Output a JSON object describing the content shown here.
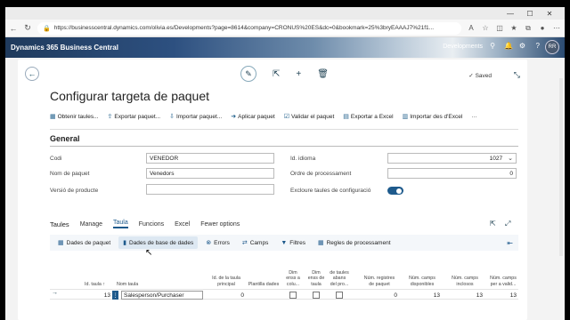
{
  "browser": {
    "url": "https://businesscentral.dynamics.com/olivia.es/Developments?page=8614&company=CRONUS%20ES&dc=0&bookmark=25%3bryEAAAJ7%21f1..."
  },
  "app": {
    "name": "Dynamics 365 Business Central",
    "environment": "Developments",
    "avatar_initials": "RR"
  },
  "page": {
    "title": "Configurar targeta de paquet",
    "saved_label": "Saved"
  },
  "actions": [
    {
      "label": "Obtenir taules...",
      "icon": "table-icon"
    },
    {
      "label": "Exportar paquet...",
      "icon": "export-icon"
    },
    {
      "label": "Importar paquet...",
      "icon": "import-icon"
    },
    {
      "label": "Aplicar paquet",
      "icon": "apply-icon"
    },
    {
      "label": "Validar el paquet",
      "icon": "validate-icon"
    },
    {
      "label": "Exportar a Excel",
      "icon": "excel-export-icon"
    },
    {
      "label": "Importar des d'Excel",
      "icon": "excel-import-icon"
    },
    {
      "label": "···",
      "icon": "more-icon"
    }
  ],
  "general": {
    "heading": "General",
    "codi_label": "Codi",
    "codi_value": "VENEDOR",
    "nom_label": "Nom de paquet",
    "nom_value": "Venedors",
    "versio_label": "Versió de producte",
    "versio_value": "",
    "idioma_label": "Id. idioma",
    "idioma_value": "1027",
    "ordre_label": "Ordre de processament",
    "ordre_value": "0",
    "excloure_label": "Excloure taules de configuració",
    "excloure_on": true
  },
  "tabs": {
    "title": "Taules",
    "items": [
      "Manage",
      "Taula",
      "Funcions",
      "Excel",
      "Fewer options"
    ],
    "active": "Taula"
  },
  "subactions": [
    {
      "label": "Dades de paquet",
      "icon": "package-data-icon"
    },
    {
      "label": "Dades de base de dades",
      "icon": "database-icon",
      "selected": true
    },
    {
      "label": "Errors",
      "icon": "errors-icon"
    },
    {
      "label": "Camps",
      "icon": "fields-icon"
    },
    {
      "label": "Filtres",
      "icon": "filter-icon"
    },
    {
      "label": "Regles de processament",
      "icon": "rules-icon"
    }
  ],
  "table": {
    "headers": {
      "id_taula": "Id. taula ↑",
      "nom_taula": "Nom taula",
      "id_principal": "Id. de la taula principal",
      "plantilla": "Plantilla dades",
      "dim_colu": "Dim enss a colu...",
      "dim_taula": "Dim enss de taula",
      "taules_abans": "de taules abans del pro...",
      "num_registres": "Núm. registres de paquet",
      "num_camps_disp": "Núm. camps disponibles",
      "num_camps_incl": "Núm. camps inclosos",
      "num_camps_valid": "Núm. camps per a valid..."
    },
    "rows": [
      {
        "id_taula": "13",
        "nom_taula": "Salesperson/Purchaser",
        "id_principal": "0",
        "plantilla": "",
        "num_registres": "0",
        "num_camps_disp": "13",
        "num_camps_incl": "13",
        "num_camps_valid": "13"
      }
    ]
  }
}
